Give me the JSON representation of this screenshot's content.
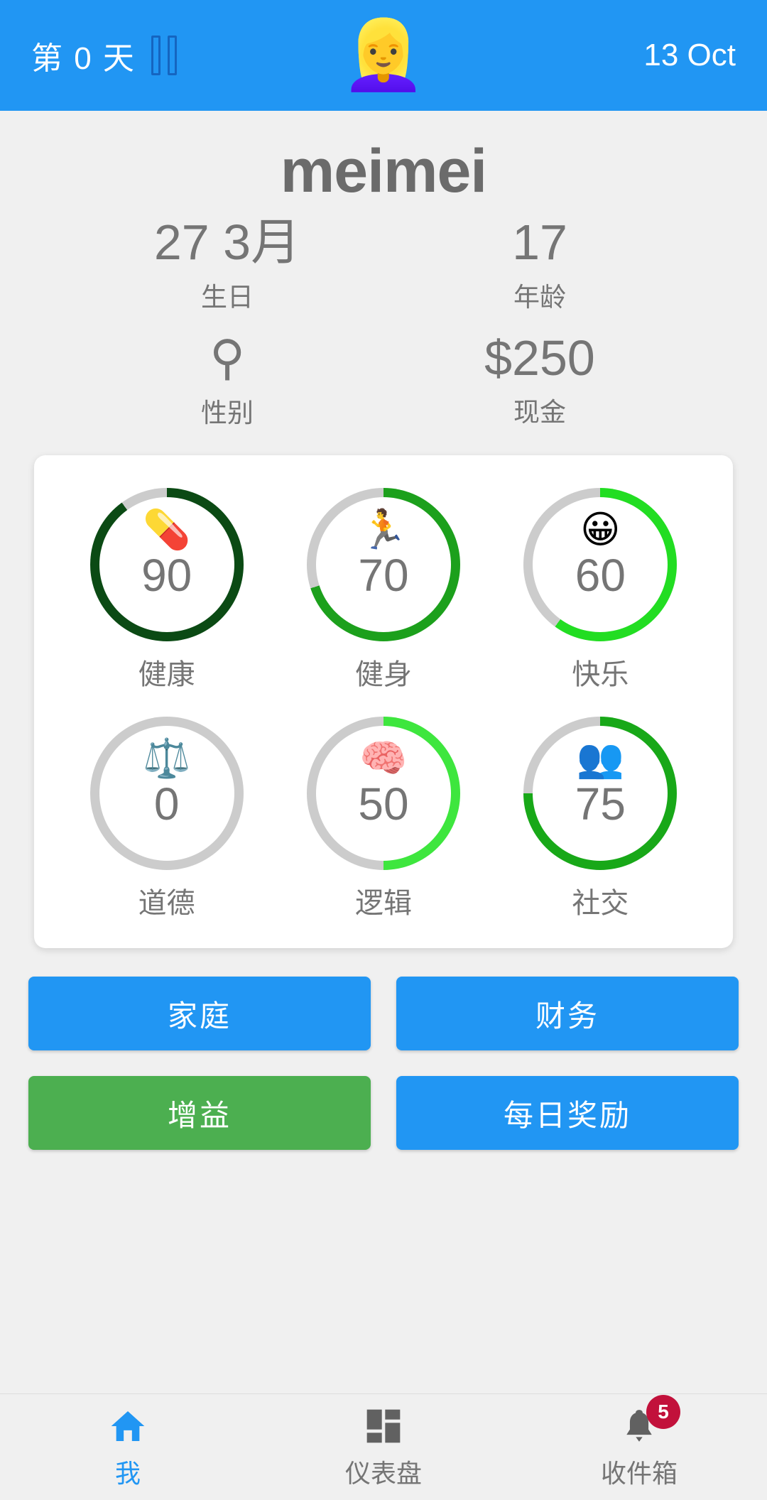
{
  "header": {
    "day_label": "第 0 天",
    "pause_icon": "pause-icon",
    "avatar_emoji": "👱‍♀️",
    "date": "13 Oct"
  },
  "profile": {
    "name": "meimei",
    "stats": [
      {
        "value": "27 3月",
        "label": "生日",
        "is_icon": false
      },
      {
        "value": "17",
        "label": "年龄",
        "is_icon": false
      },
      {
        "value": "⚲",
        "label": "性别",
        "is_icon": true
      },
      {
        "value": "$250",
        "label": "现金",
        "is_icon": false
      }
    ]
  },
  "attributes": {
    "ring_track_color": "#cccccc",
    "items": [
      {
        "label": "健康",
        "value": 90,
        "display": "90",
        "emoji": "💊",
        "color": "#0b4a14"
      },
      {
        "label": "健身",
        "value": 70,
        "display": "70",
        "emoji": "🏃",
        "color": "#1ca01c"
      },
      {
        "label": "快乐",
        "value": 60,
        "display": "60",
        "emoji": "😀",
        "color": "#22dd22"
      },
      {
        "label": "道德",
        "value": 0,
        "display": "0",
        "emoji": "⚖️",
        "color": "#cccccc"
      },
      {
        "label": "逻辑",
        "value": 50,
        "display": "50",
        "emoji": "🧠",
        "color": "#3ee63e"
      },
      {
        "label": "社交",
        "value": 75,
        "display": "75",
        "emoji": "👥",
        "color": "#18a818"
      }
    ]
  },
  "actions": [
    {
      "label": "家庭",
      "color": "#2196f3",
      "style": "blue"
    },
    {
      "label": "财务",
      "color": "#2196f3",
      "style": "blue"
    },
    {
      "label": "增益",
      "color": "#4caf50",
      "style": "green"
    },
    {
      "label": "每日奖励",
      "color": "#2196f3",
      "style": "blue"
    }
  ],
  "bottom_nav": {
    "items": [
      {
        "label": "我",
        "icon": "home-icon",
        "active": true,
        "badge": null
      },
      {
        "label": "仪表盘",
        "icon": "dashboard-icon",
        "active": false,
        "badge": null
      },
      {
        "label": "收件箱",
        "icon": "bell-icon",
        "active": false,
        "badge": "5"
      }
    ]
  }
}
